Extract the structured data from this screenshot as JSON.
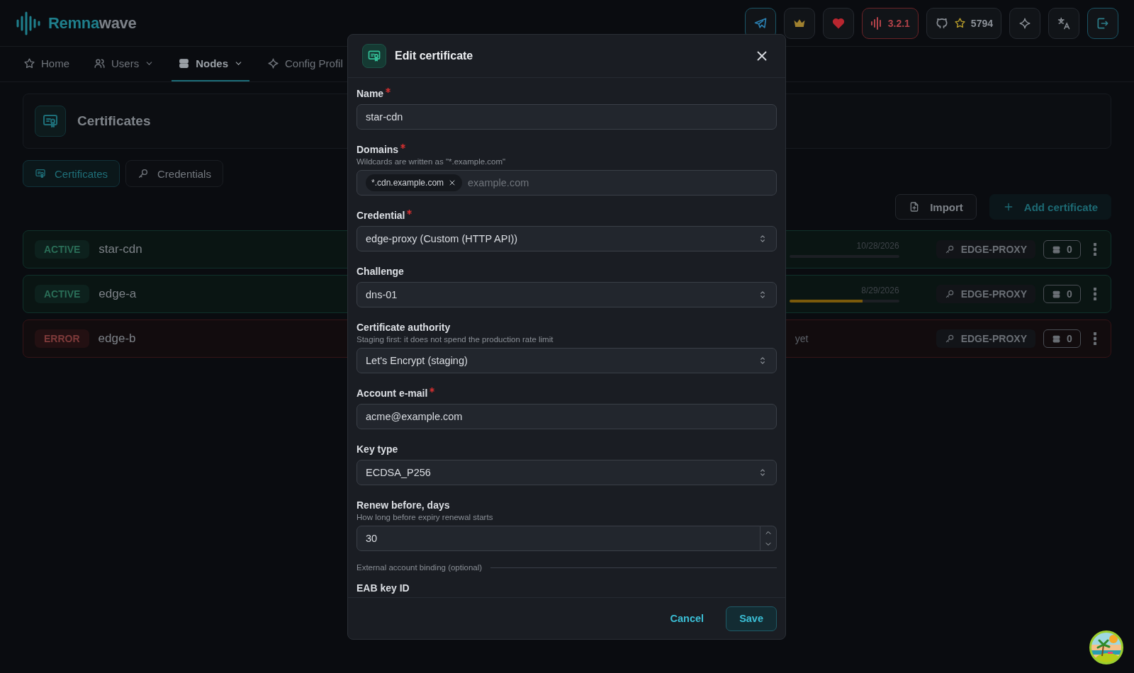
{
  "header": {
    "logo": {
      "first": "Remna",
      "second": "wave"
    },
    "version": "3.2.1",
    "stars": "5794"
  },
  "nav": [
    {
      "label": "Home",
      "dropdown": false,
      "selected": false
    },
    {
      "label": "Users",
      "dropdown": true,
      "selected": false
    },
    {
      "label": "Nodes",
      "dropdown": true,
      "selected": true
    },
    {
      "label": "Config Profil",
      "dropdown": false,
      "selected": false
    }
  ],
  "page": {
    "title": "Certificates",
    "tabs": [
      {
        "label": "Certificates",
        "selected": true
      },
      {
        "label": "Credentials",
        "selected": false
      }
    ],
    "actions": [
      {
        "label": "Import",
        "kind": "secondary"
      },
      {
        "label": "Add certificate",
        "kind": "primary"
      }
    ],
    "rows": [
      {
        "status": "ACTIVE",
        "kind": "active",
        "name": "star-cdn",
        "expires": "10/28/2026",
        "level": 0,
        "credential": "EDGE-PROXY",
        "nodes": "0"
      },
      {
        "status": "ACTIVE",
        "kind": "active",
        "name": "edge-a",
        "expires": "8/29/2026",
        "level": 0.67,
        "credential": "EDGE-PROXY",
        "nodes": "0"
      },
      {
        "status": "ERROR",
        "kind": "error",
        "name": "edge-b",
        "note": "yet",
        "credential": "EDGE-PROXY",
        "nodes": "0"
      }
    ]
  },
  "modal": {
    "title": "Edit certificate",
    "fields": [
      {
        "kind": "text",
        "label": "Name",
        "required": true,
        "value": "star-cdn"
      },
      {
        "kind": "tags",
        "label": "Domains",
        "required": true,
        "hint": "Wildcards are written as \"*.example.com\"",
        "tags": [
          "*.cdn.example.com"
        ],
        "placeholder": "example.com"
      },
      {
        "kind": "select",
        "label": "Credential",
        "required": true,
        "value": "edge-proxy (Custom (HTTP API))"
      },
      {
        "kind": "select",
        "label": "Challenge",
        "required": false,
        "value": "dns-01"
      },
      {
        "kind": "select",
        "label": "Certificate authority",
        "required": false,
        "hint": "Staging first: it does not spend the production rate limit",
        "value": "Let's Encrypt (staging)"
      },
      {
        "kind": "text",
        "label": "Account e-mail",
        "required": true,
        "value": "acme@example.com"
      },
      {
        "kind": "select",
        "label": "Key type",
        "required": false,
        "value": "ECDSA_P256"
      },
      {
        "kind": "number",
        "label": "Renew before, days",
        "required": false,
        "hint": "How long before expiry renewal starts",
        "value": "30"
      }
    ],
    "section": "External account binding (optional)",
    "next_label": "EAB key ID",
    "buttons": [
      {
        "label": "Cancel",
        "kind": "subtle"
      },
      {
        "label": "Save",
        "kind": "filled"
      }
    ]
  }
}
